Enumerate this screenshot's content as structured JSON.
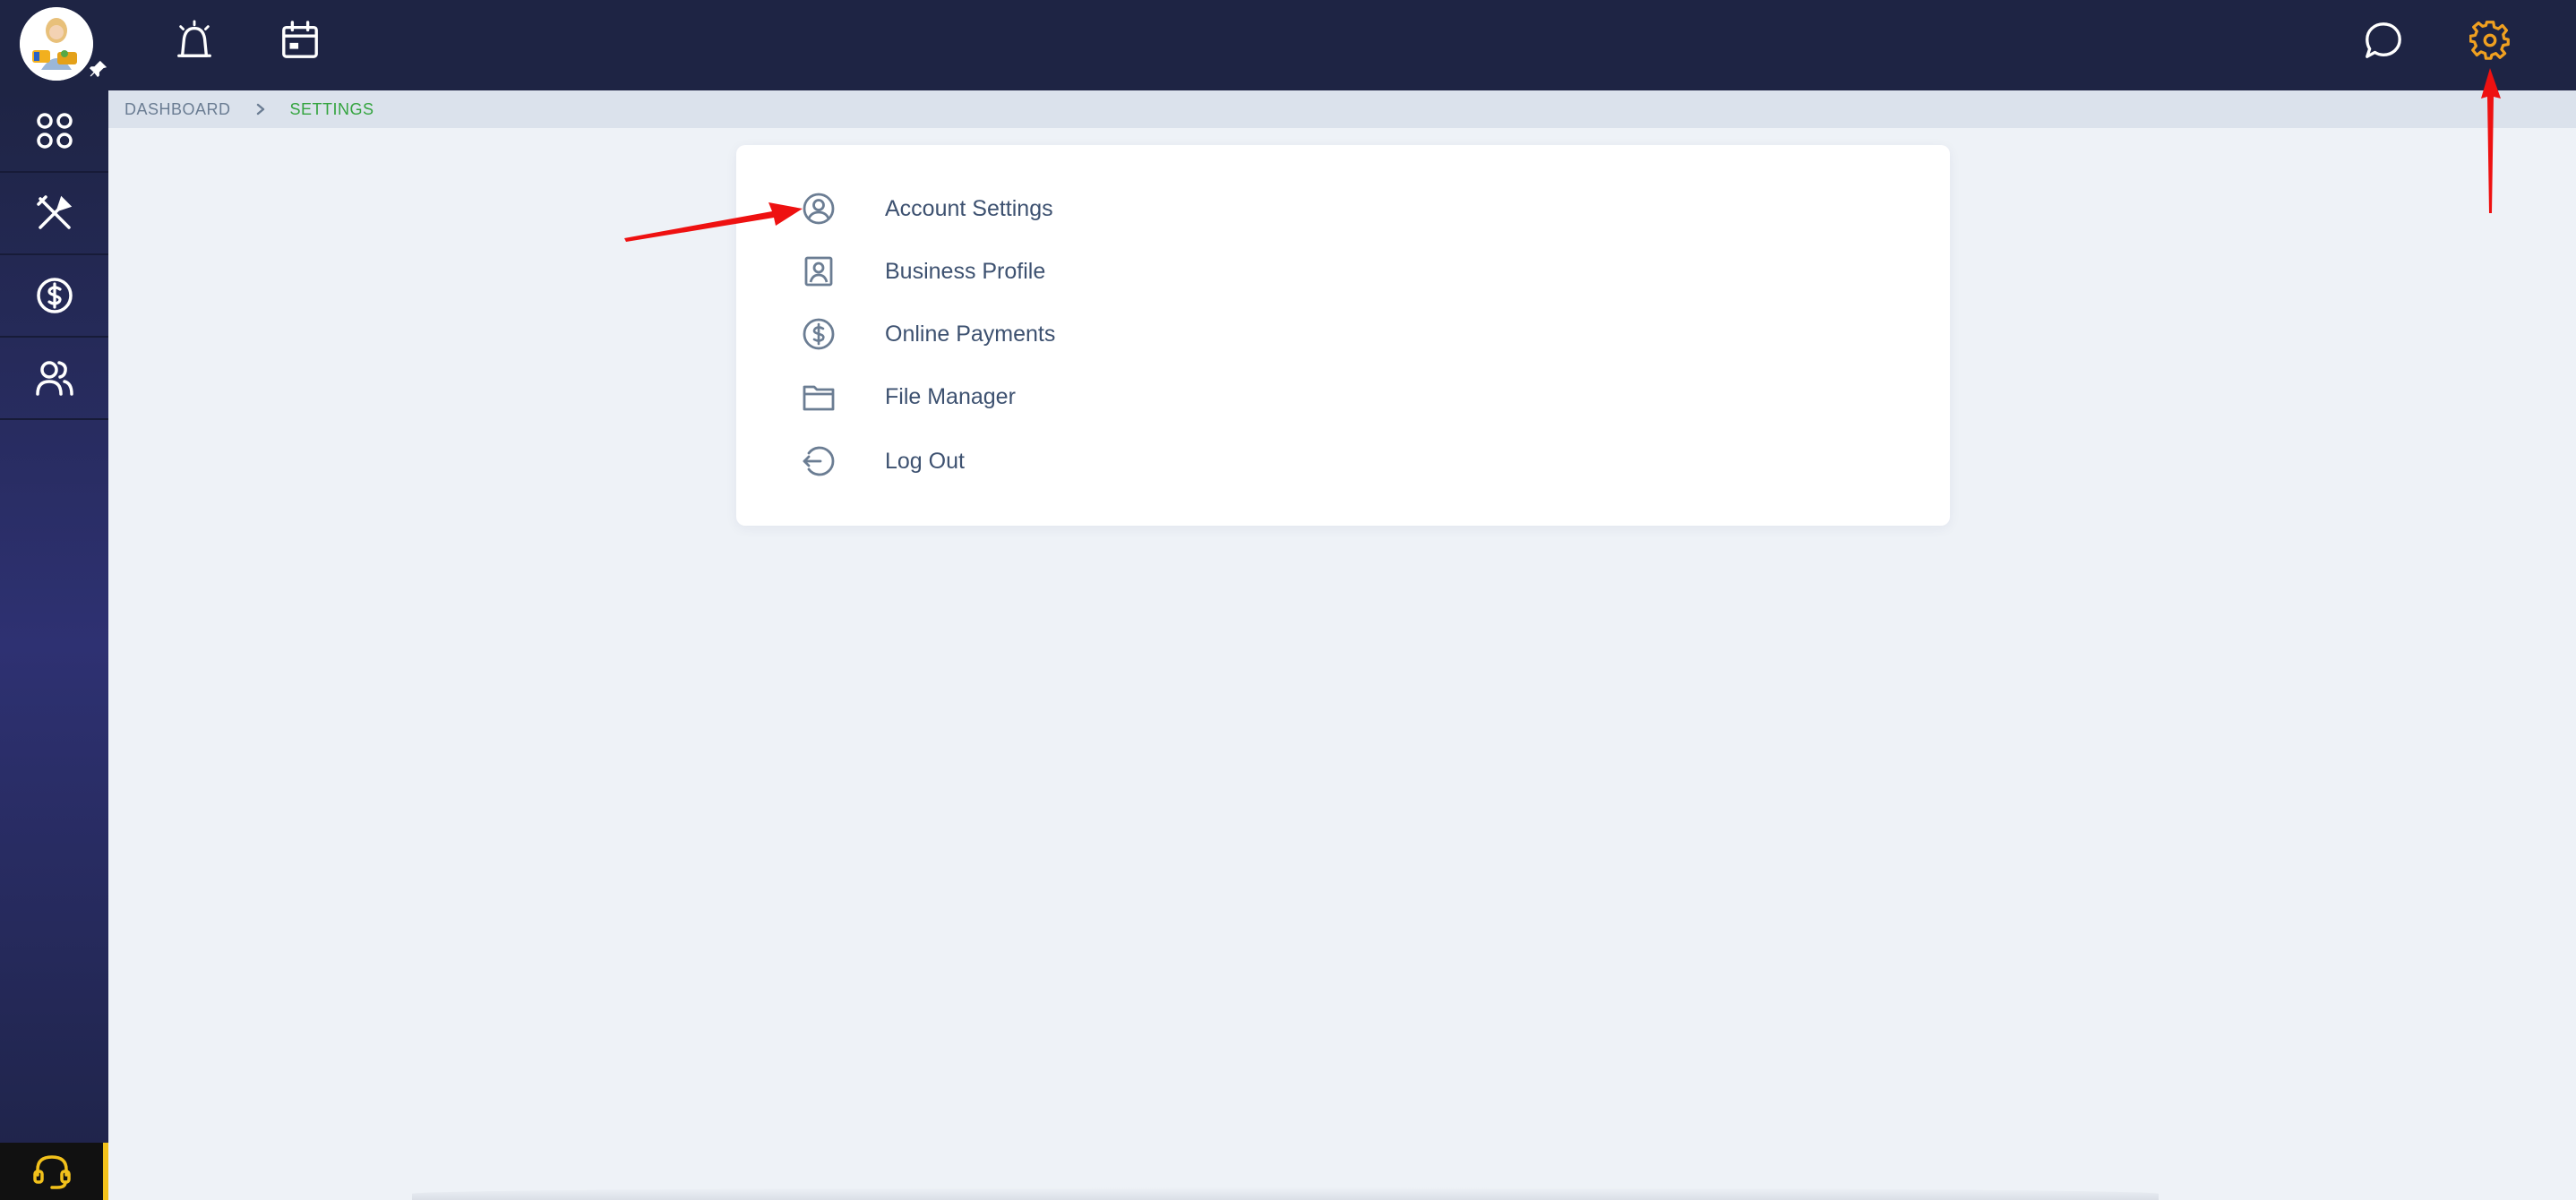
{
  "breadcrumb": {
    "home": "DASHBOARD",
    "current": "SETTINGS"
  },
  "colors": {
    "topbar": "#1e2444",
    "accent_gear": "#f0a020",
    "breadcrumb_current": "#34a43f",
    "annotation_arrow": "#ee1111",
    "support_accent": "#f2c11b"
  },
  "topbar": {
    "left_icons": [
      "alarm-icon",
      "calendar-icon"
    ],
    "right_icons": [
      "chat-icon",
      "gear-icon"
    ]
  },
  "sidebar": {
    "items": [
      {
        "icon": "apps-grid-icon"
      },
      {
        "icon": "tools-icon"
      },
      {
        "icon": "dollar-circle-icon"
      },
      {
        "icon": "users-icon"
      }
    ],
    "support_icon": "headset-icon"
  },
  "settings_menu": {
    "items": [
      {
        "label": "Account Settings",
        "icon": "user-circle-icon"
      },
      {
        "label": "Business Profile",
        "icon": "id-card-icon"
      },
      {
        "label": "Online Payments",
        "icon": "dollar-circle-icon"
      },
      {
        "label": "File Manager",
        "icon": "folder-icon"
      },
      {
        "label": "Log Out",
        "icon": "logout-icon"
      }
    ]
  }
}
